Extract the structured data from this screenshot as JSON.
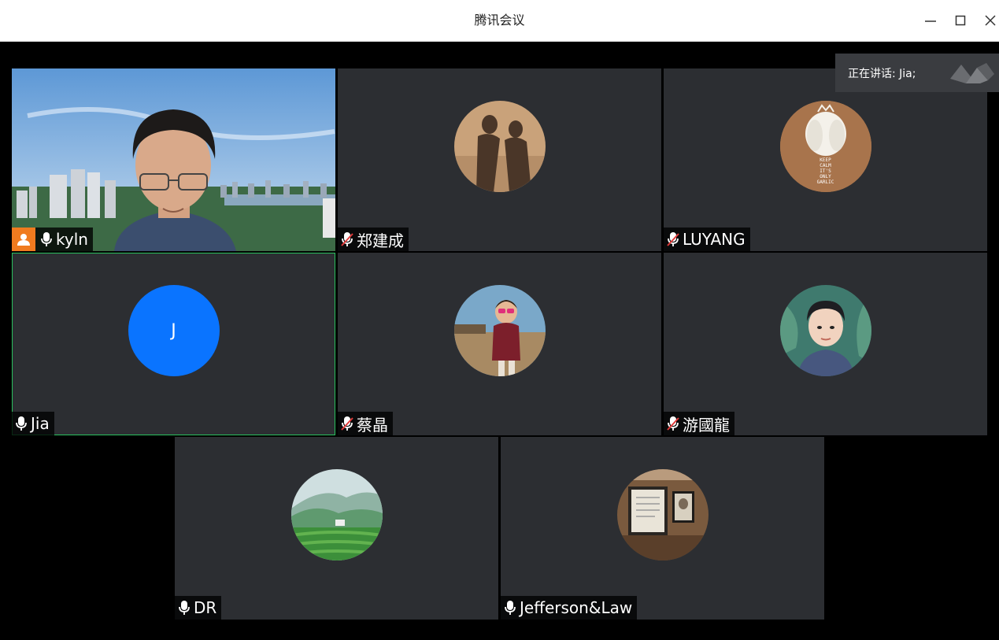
{
  "window": {
    "title": "腾讯会议"
  },
  "speaking_banner": {
    "label": "正在讲话: Jia;"
  },
  "participants": [
    {
      "name": "kyln",
      "mic": "on",
      "is_host": true,
      "avatar": "video-man-cityscape"
    },
    {
      "name": "郑建成",
      "mic": "muted",
      "avatar": "shadows-on-sand"
    },
    {
      "name": "LUYANG",
      "mic": "muted",
      "avatar": "garlic-keep-calm",
      "avatar_text": "KEEP CALM IT'S ONLY GARLIC"
    },
    {
      "name": "Jia",
      "mic": "on",
      "speaking": true,
      "avatar": "letter",
      "avatar_letter": "J",
      "avatar_color": "#0a74ff"
    },
    {
      "name": "蔡晶",
      "mic": "muted",
      "avatar": "child-sunglasses"
    },
    {
      "name": "游國龍",
      "mic": "muted",
      "avatar": "cartoon-man"
    },
    {
      "name": "DR",
      "mic": "on",
      "avatar": "tea-fields"
    },
    {
      "name": "Jefferson&Law",
      "mic": "on",
      "avatar": "framed-document"
    }
  ],
  "colors": {
    "tile_bg": "#2c2e32",
    "active_border": "#29c15e",
    "host_badge": "#f07b1f",
    "muted_slash": "#e23b3b"
  }
}
